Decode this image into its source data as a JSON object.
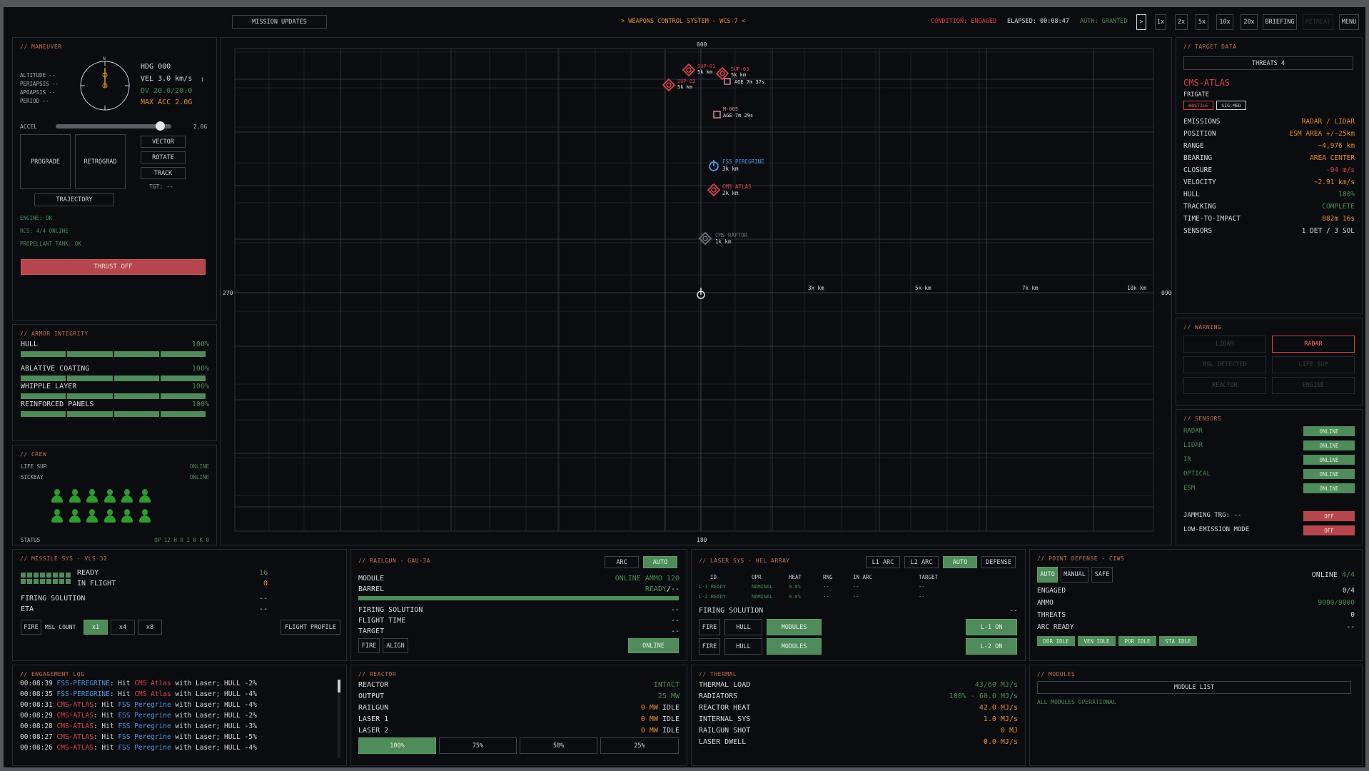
{
  "topbar": {
    "mission_updates": "MISSION UPDATES",
    "title": "> WEAPONS CONTROL SYSTEM - WCS-7 <",
    "condition": "CONDITION: ENGAGED",
    "elapsed": "ELAPSED: 00:08:47",
    "auth": "AUTH: GRANTED",
    "speed": [
      ">",
      "1x",
      "2x",
      "5x",
      "10x",
      "20x"
    ],
    "briefing": "BRIEFING",
    "retreat": "RETREAT",
    "menu": "MENU"
  },
  "maneuver": {
    "title": "// MANEUVER",
    "altitude": "ALTITUDE --",
    "periapsis": "PERIAPSIS --",
    "apoapsis": "APOAPSIS --",
    "period": "PERIOD --",
    "compass_n": "N",
    "hdg": "HDG 000",
    "vel": "VEL 3.0 km/s",
    "vel_unit": "i",
    "dv": "DV 20.0/20.0",
    "max_acc": "MAX ACC 2.0G",
    "accel": "ACCEL",
    "accel_val": "2.0G",
    "accel_fraction": 0.9,
    "prograde": "PROGRADE",
    "retrograde": "RETROGRAD",
    "vector": "VECTOR",
    "rotate": "ROTATE",
    "track": "TRACK",
    "tgt": "TGT: --",
    "trajectory": "TRAJECTORY",
    "engine": "ENGINE: OK",
    "rcs": "RCS: 4/4 ONLINE",
    "prop": "PROPELLANT TANK: OK",
    "thrust": "THRUST OFF"
  },
  "armor": {
    "title": "// ARMOR INTEGRITY",
    "items": [
      {
        "label": "HULL",
        "value": "100%"
      },
      {
        "label": "ABLATIVE COATING",
        "value": "100%"
      },
      {
        "label": "WHIPPLE LAYER",
        "value": "100%"
      },
      {
        "label": "REINFORCED PANELS",
        "value": "100%"
      }
    ]
  },
  "crew": {
    "title": "// CREW",
    "life_sup": "LIFE SUP",
    "life_sup_v": "ONLINE",
    "sickbay": "SICKBAY",
    "sickbay_v": "ONLINE",
    "status": "STATUS",
    "status_v": "OP 12  H 0  I 0  K 0"
  },
  "radar": {
    "n": "000",
    "s": "180",
    "w": "270",
    "e": "090",
    "rings": [
      "3k km",
      "5k km",
      "7k km",
      "10k km"
    ],
    "contacts": [
      {
        "name": "SUP-01",
        "range": "5k km"
      },
      {
        "name": "SUP-02",
        "range": "5k km"
      },
      {
        "name": "SUP-03",
        "range": "5k km",
        "age": "AGE 7m 37s"
      },
      {
        "name": "M-005",
        "age": "AGE 7m 29s"
      },
      {
        "name": "FSS PEREGRINE",
        "range": "3k km"
      },
      {
        "name": "CMS ATLAS",
        "range": "2k km"
      },
      {
        "name": "CMS RAPTOR",
        "range": "1k km"
      }
    ]
  },
  "target": {
    "title": "// TARGET DATA",
    "threats": "THREATS 4",
    "name": "CMS-ATLAS",
    "class": "FRIGATE",
    "hostile": "HOSTILE",
    "sig": "SIG:MED",
    "rows": [
      {
        "k": "EMISSIONS",
        "v": "RADAR / LIDAR"
      },
      {
        "k": "POSITION",
        "v": "ESM AREA +/-25km"
      },
      {
        "k": "RANGE",
        "v": "~4,976 km"
      },
      {
        "k": "BEARING",
        "v": "AREA CENTER"
      },
      {
        "k": "CLOSURE",
        "v": "-94 m/s"
      },
      {
        "k": "VELOCITY",
        "v": "~2.91 km/s"
      },
      {
        "k": "HULL",
        "v": "100%"
      },
      {
        "k": "TRACKING",
        "v": "COMPLETE"
      },
      {
        "k": "TIME-TO-IMPACT",
        "v": "882m 16s"
      },
      {
        "k": "SENSORS",
        "v": "1 DET / 3 SOL"
      }
    ]
  },
  "warning": {
    "title": "// WARNING",
    "items": [
      "LIDAR",
      "RADAR",
      "MSL DETECTED",
      "LIFE SUP",
      "REACTOR",
      "ENGINE"
    ]
  },
  "sensors": {
    "title": "// SENSORS",
    "items": [
      {
        "k": "RADAR",
        "v": "ONLINE"
      },
      {
        "k": "LIDAR",
        "v": "ONLINE"
      },
      {
        "k": "IR",
        "v": "ONLINE"
      },
      {
        "k": "OPTICAL",
        "v": "ONLINE"
      },
      {
        "k": "ESM",
        "v": "ONLINE"
      }
    ],
    "jamming": "JAMMING TRG: --",
    "jamming_v": "OFF",
    "lowem": "LOW-EMISSION MODE",
    "lowem_v": "OFF"
  },
  "missile": {
    "title": "// MISSILE SYS - VLS-32",
    "ready": "READY",
    "ready_v": "16",
    "inflight": "IN FLIGHT",
    "inflight_v": "0",
    "firing": "FIRING SOLUTION",
    "firing_v": "--",
    "eta": "ETA",
    "eta_v": "--",
    "fire": "FIRE",
    "msl_count": "MSL COUNT",
    "x1": "x1",
    "x4": "x4",
    "x8": "x8",
    "flight_profile": "FLIGHT PROFILE"
  },
  "railgun": {
    "title": "// RAILGUN - GAU-3A",
    "arc": "ARC",
    "auto": "AUTO",
    "module": "MODULE",
    "module_v": "ONLINE AMMO 120",
    "barrel": "BARREL",
    "barrel_v": "READY",
    "barrel_v2": "/--",
    "firing": "FIRING SOLUTION",
    "firing_v": "--",
    "flight": "FLIGHT TIME",
    "flight_v": "--",
    "target": "TARGET",
    "target_v": "--",
    "fire": "FIRE",
    "align": "ALIGN",
    "online": "ONLINE"
  },
  "laser": {
    "title": "// LASER SYS - HEL ARRAY",
    "l1arc": "L1 ARC",
    "l2arc": "L2 ARC",
    "auto": "AUTO",
    "defense": "DEFENSE",
    "cols": [
      "ID",
      "OPR",
      "HEAT",
      "RNG",
      "IN ARC",
      "TARGET"
    ],
    "rows": [
      [
        "L-1 READY",
        "NOMINAL",
        "0.0%",
        "--",
        "--",
        "--"
      ],
      [
        "L-2 READY",
        "NOMINAL",
        "0.0%",
        "--",
        "--",
        "--"
      ]
    ],
    "firing": "FIRING SOLUTION",
    "firing_v": "--",
    "fire": "FIRE",
    "hull": "HULL",
    "modules": "MODULES",
    "l1on": "L-1 ON",
    "l2on": "L-2 ON"
  },
  "pd": {
    "title": "// POINT DEFENSE - CIWS",
    "auto": "AUTO",
    "manual": "MANUAL",
    "safe": "SAFE",
    "online": "ONLINE",
    "online_v": "4/4",
    "engaged": "ENGAGED",
    "engaged_v": "0/4",
    "ammo": "AMMO",
    "ammo_v": "9000/9000",
    "threats": "THREATS",
    "threats_v": "0",
    "arc": "ARC READY",
    "arc_v": "--",
    "idle": [
      "DOR IDLE",
      "VEN IDLE",
      "POR IDLE",
      "STA IDLE"
    ]
  },
  "log": {
    "title": "// ENGAGEMENT LOG",
    "entries": [
      {
        "t": "00:08:39",
        "who": "FSS-PEREGRINE",
        "c": "blue",
        "tgt": "CMS Atlas",
        "tc": "red",
        "hull": "-2%"
      },
      {
        "t": "00:08:35",
        "who": "FSS-PEREGRINE",
        "c": "blue",
        "tgt": "CMS Atlas",
        "tc": "red",
        "hull": "-4%"
      },
      {
        "t": "00:08:31",
        "who": "CMS-ATLAS",
        "c": "red",
        "tgt": "FSS Peregrine",
        "tc": "blue",
        "hull": "-4%"
      },
      {
        "t": "00:08:29",
        "who": "CMS-ATLAS",
        "c": "red",
        "tgt": "FSS Peregrine",
        "tc": "blue",
        "hull": "-2%"
      },
      {
        "t": "00:08:28",
        "who": "CMS-ATLAS",
        "c": "red",
        "tgt": "FSS Peregrine",
        "tc": "blue",
        "hull": "-3%"
      },
      {
        "t": "00:08:27",
        "who": "CMS-ATLAS",
        "c": "red",
        "tgt": "FSS Peregrine",
        "tc": "blue",
        "hull": "-5%"
      },
      {
        "t": "00:08:26",
        "who": "CMS-ATLAS",
        "c": "red",
        "tgt": "FSS Peregrine",
        "tc": "blue",
        "hull": "-4%"
      }
    ],
    "hit": ": Hit ",
    "with": " with Laser; HULL "
  },
  "reactor": {
    "title": "// REACTOR",
    "rows": [
      {
        "k": "REACTOR",
        "v": "INTACT",
        "c": "dgreen"
      },
      {
        "k": "OUTPUT",
        "v": "25 MW",
        "c": "dgreen"
      },
      {
        "k": "RAILGUN",
        "v": "0 MW",
        "v2": "IDLE"
      },
      {
        "k": "LASER 1",
        "v": "0 MW",
        "v2": "IDLE"
      },
      {
        "k": "LASER 2",
        "v": "0 MW",
        "v2": "IDLE"
      }
    ],
    "levels": [
      "100%",
      "75%",
      "50%",
      "25%"
    ]
  },
  "thermal": {
    "title": "// THERMAL",
    "rows": [
      {
        "k": "THERMAL LOAD",
        "v": "43/60 MJ/s",
        "c": "dgreen"
      },
      {
        "k": "RADIATORS",
        "v": "100% - 60.0 MJ/s",
        "c": "dgreen"
      },
      {
        "k": "REACTOR HEAT",
        "v": "42.0 MJ/s",
        "c": "orange"
      },
      {
        "k": "INTERNAL SYS",
        "v": "1.0 MJ/s",
        "c": "orange"
      },
      {
        "k": "RAILGUN SHOT",
        "v": "0 MJ",
        "c": "orange"
      },
      {
        "k": "LASER DWELL",
        "v": "0.0 MJ/s",
        "c": "orange"
      }
    ]
  },
  "modules": {
    "title": "// MODULES",
    "list": "MODULE LIST",
    "status": "ALL MODULES OPERATIONAL"
  }
}
